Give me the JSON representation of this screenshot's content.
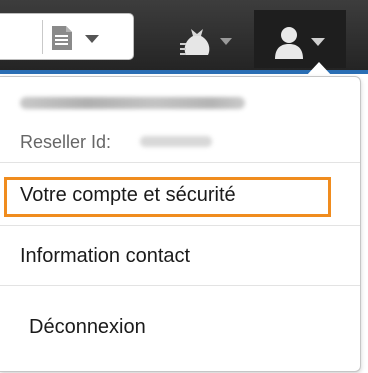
{
  "toolbar": {
    "search_icon": "document-icon",
    "reseller_icon": "money-bag-icon",
    "account_icon": "user-icon",
    "colors": {
      "toolbar_background": "#2b2b2b",
      "accent_bar": "#2a6eb4",
      "highlight": "#f08c1e"
    }
  },
  "account": {
    "reseller_label": "Reseller Id:"
  },
  "menu": {
    "items": [
      {
        "label": "Votre compte et sécurité",
        "highlighted": true
      },
      {
        "label": "Information contact",
        "highlighted": false
      },
      {
        "label": "Déconnexion",
        "highlighted": false
      }
    ]
  }
}
